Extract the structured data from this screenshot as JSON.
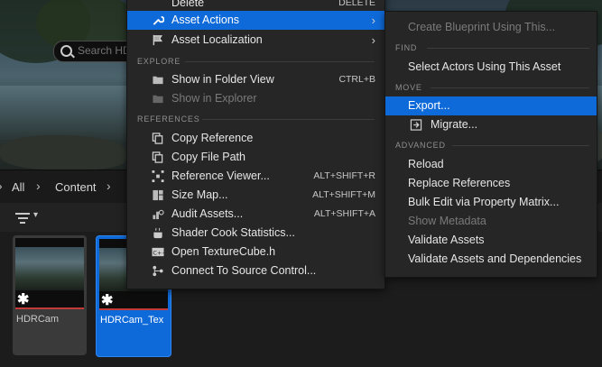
{
  "path_bar": {
    "all": "All",
    "content": "Content"
  },
  "search": {
    "placeholder": "Search HDRCam"
  },
  "tiles": [
    {
      "name": "HDRCam"
    },
    {
      "name": "HDRCam_Tex"
    }
  ],
  "context_menu": {
    "top_item": {
      "label": "Delete",
      "shortcut": "DELETE"
    },
    "asset_actions": "Asset Actions",
    "asset_localization": "Asset Localization",
    "section_explore": "EXPLORE",
    "show_in_folder": {
      "label": "Show in Folder View",
      "shortcut": "CTRL+B"
    },
    "show_in_explorer": "Show in Explorer",
    "section_references": "REFERENCES",
    "copy_reference": "Copy Reference",
    "copy_file_path": "Copy File Path",
    "reference_viewer": {
      "label": "Reference Viewer...",
      "shortcut": "ALT+SHIFT+R"
    },
    "size_map": {
      "label": "Size Map...",
      "shortcut": "ALT+SHIFT+M"
    },
    "audit_assets": {
      "label": "Audit Assets...",
      "shortcut": "ALT+SHIFT+A"
    },
    "shader_cook": "Shader Cook Statistics...",
    "open_texturecube": "Open TextureCube.h",
    "connect_source": "Connect To Source Control..."
  },
  "submenu": {
    "create_blueprint": "Create Blueprint Using This...",
    "section_find": "FIND",
    "select_actors": "Select Actors Using This Asset",
    "section_move": "MOVE",
    "export": "Export...",
    "migrate": "Migrate...",
    "section_advanced": "ADVANCED",
    "reload": "Reload",
    "replace_references": "Replace References",
    "bulk_edit": "Bulk Edit via Property Matrix...",
    "show_metadata": "Show Metadata",
    "validate_assets": "Validate Assets",
    "validate_deps": "Validate Assets and Dependencies"
  },
  "colors": {
    "highlight": "#0f6ad9",
    "menu_bg": "#262626",
    "selection_outline": "#c23a3a"
  }
}
